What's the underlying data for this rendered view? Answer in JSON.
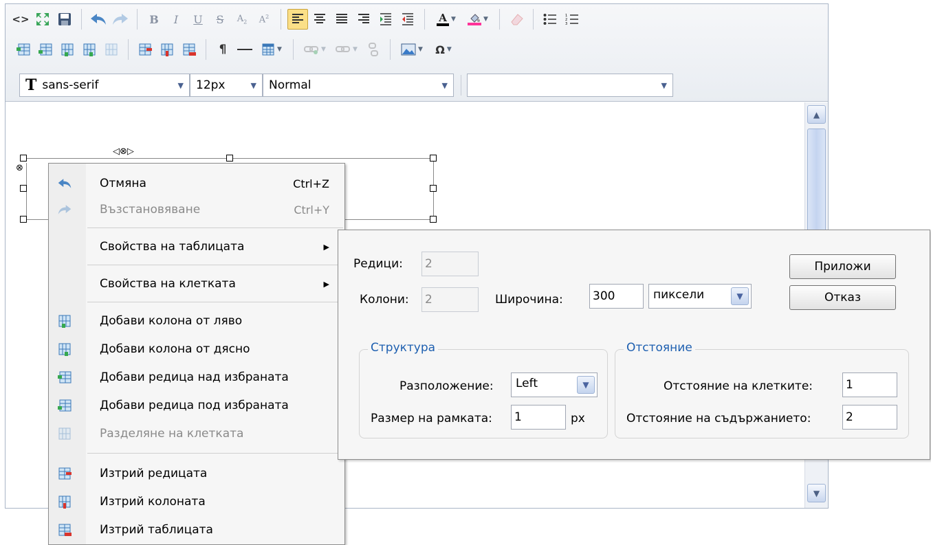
{
  "toolbar": {
    "row1": [
      {
        "name": "source-icon",
        "glyph": "<>"
      },
      {
        "name": "fullscreen-icon",
        "glyph": "⛶"
      },
      {
        "name": "save-icon",
        "glyph": "💾"
      },
      {
        "name": "undo-icon",
        "glyph": "↶"
      },
      {
        "name": "redo-icon",
        "glyph": "↷"
      },
      {
        "name": "bold-icon",
        "glyph": "B"
      },
      {
        "name": "italic-icon",
        "glyph": "I"
      },
      {
        "name": "underline-icon",
        "glyph": "U"
      },
      {
        "name": "strikethrough-icon",
        "glyph": "S"
      },
      {
        "name": "subscript-icon",
        "glyph": "A₂"
      },
      {
        "name": "superscript-icon",
        "glyph": "A²"
      },
      {
        "name": "align-left-icon",
        "glyph": "≡"
      },
      {
        "name": "align-center-icon",
        "glyph": "≡"
      },
      {
        "name": "align-justify-icon",
        "glyph": "≡"
      },
      {
        "name": "align-right-icon",
        "glyph": "≡"
      },
      {
        "name": "indent-icon",
        "glyph": "≡"
      },
      {
        "name": "outdent-icon",
        "glyph": "≡"
      },
      {
        "name": "font-color-icon",
        "glyph": "A"
      },
      {
        "name": "highlight-color-icon",
        "glyph": "◈"
      },
      {
        "name": "eraser-icon",
        "glyph": "⌫"
      },
      {
        "name": "bullet-list-icon",
        "glyph": "☰"
      },
      {
        "name": "numbered-list-icon",
        "glyph": "☰"
      }
    ],
    "font_family": "sans-serif",
    "font_size": "12px",
    "block_format": "Normal",
    "style_value": ""
  },
  "context_menu": {
    "undo": {
      "label": "Отмяна",
      "shortcut": "Ctrl+Z"
    },
    "redo": {
      "label": "Възстановяване",
      "shortcut": "Ctrl+Y"
    },
    "table_props": {
      "label": "Свойства на таблицата"
    },
    "cell_props": {
      "label": "Свойства на клетката"
    },
    "col_left": {
      "label": "Добави колона от ляво"
    },
    "col_right": {
      "label": "Добави колона от дясно"
    },
    "row_above": {
      "label": "Добави редица над избраната"
    },
    "row_below": {
      "label": "Добави редица под избраната"
    },
    "split_cell": {
      "label": "Разделяне на клетката"
    },
    "delete_row": {
      "label": "Изтрий редицата"
    },
    "delete_col": {
      "label": "Изтрий колоната"
    },
    "delete_table": {
      "label": "Изтрий таблицата"
    }
  },
  "dialog": {
    "rows_label": "Редици:",
    "rows_value": "2",
    "cols_label": "Колони:",
    "cols_value": "2",
    "width_label": "Широчина:",
    "width_value": "300",
    "width_unit": "пиксели",
    "apply_label": "Приложи",
    "cancel_label": "Отказ",
    "structure_legend": "Структура",
    "align_label": "Разположение:",
    "align_value": "Left",
    "border_label": "Размер на рамката:",
    "border_value": "1",
    "border_unit": "px",
    "spacing_legend": "Отстояние",
    "cellspacing_label": "Отстояние на клетките:",
    "cellspacing_value": "1",
    "cellpadding_label": "Отстояние на съдържанието:",
    "cellpadding_value": "2"
  },
  "colors": {
    "accent_blue": "#1d5fb0",
    "active_button": "#fbdf87",
    "font_color_bar": "#000000",
    "highlight_bar": "#ff3399"
  }
}
